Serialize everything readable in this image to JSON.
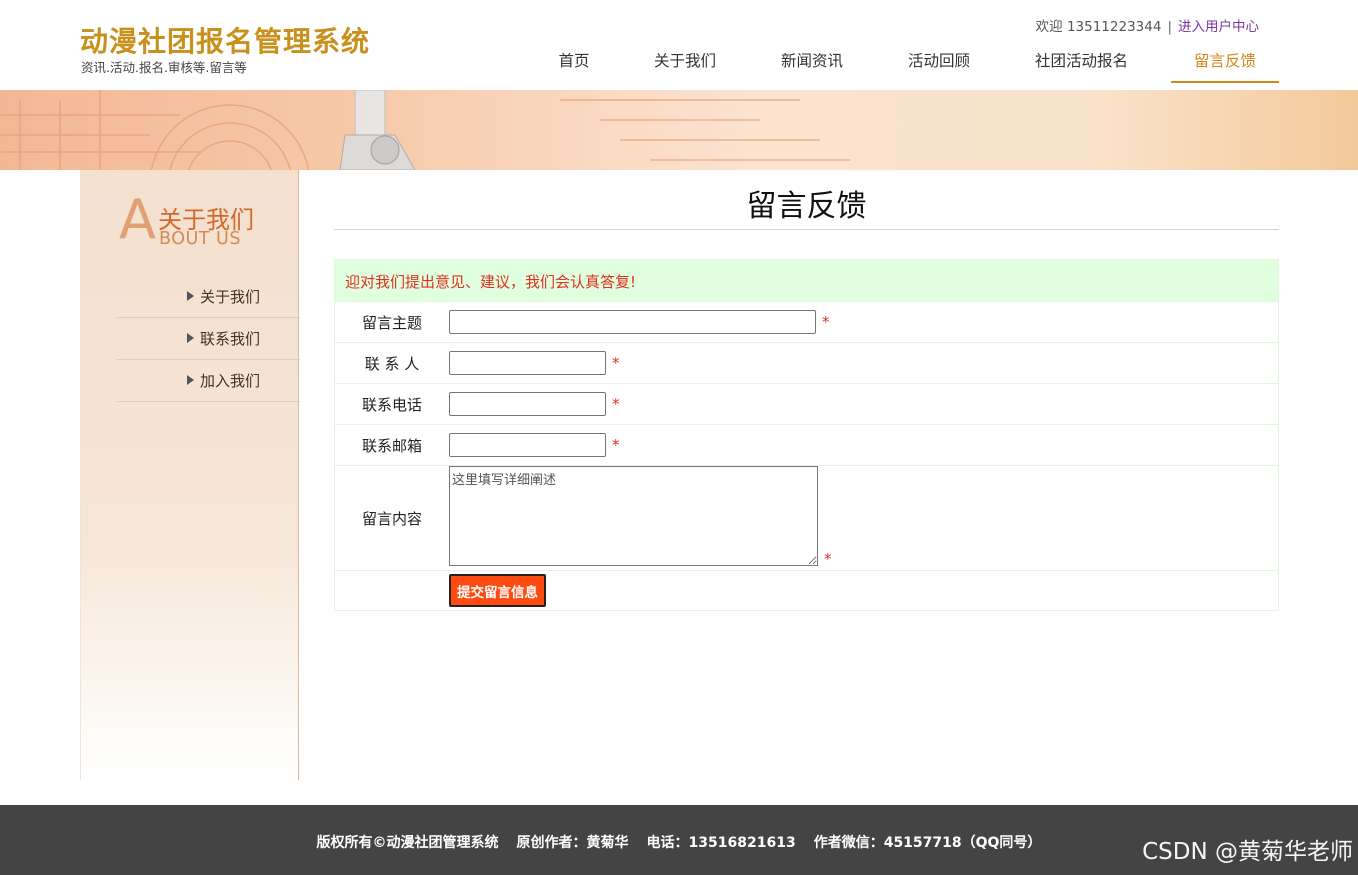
{
  "header": {
    "logo_title": "动漫社团报名管理系统",
    "logo_subtitle": "资讯.活动.报名.审核等.留言等",
    "welcome": "欢迎 13511223344",
    "separator": "|",
    "user_center": "进入用户中心",
    "nav": [
      {
        "label": "首页"
      },
      {
        "label": "关于我们"
      },
      {
        "label": "新闻资讯"
      },
      {
        "label": "活动回顾"
      },
      {
        "label": "社团活动报名"
      },
      {
        "label": "留言反馈"
      }
    ],
    "active_nav": "留言反馈"
  },
  "sidebar": {
    "big_letter": "A",
    "title_cn": "关于我们",
    "title_en": "BOUT US",
    "items": [
      {
        "label": "关于我们"
      },
      {
        "label": "联系我们"
      },
      {
        "label": "加入我们"
      }
    ]
  },
  "main": {
    "page_title": "留言反馈",
    "notice": "迎对我们提出意见、建议，我们会认真答复!",
    "form": {
      "subject_label": "留言主题",
      "contact_label": "联 系 人",
      "phone_label": "联系电话",
      "email_label": "联系邮箱",
      "content_label": "留言内容",
      "content_placeholder": "这里填写详细阐述",
      "required_mark": "*",
      "submit_label": "提交留言信息"
    }
  },
  "footer": {
    "copyright": "版权所有©动漫社团管理系统",
    "author": "原创作者：黄菊华",
    "phone": "电话：13516821613",
    "wechat": "作者微信：45157718（QQ同号）"
  },
  "watermark": "CSDN @黄菊华老师",
  "colors": {
    "accent": "#d4871b",
    "logo": "#c8901c",
    "notice_bg": "#dfffdf",
    "notice_text": "#e0301f",
    "submit_bg": "#ff4b12",
    "footer_bg": "#444444"
  }
}
